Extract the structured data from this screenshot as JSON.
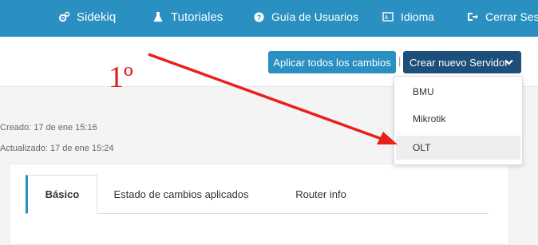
{
  "nav": {
    "items": [
      {
        "label": "Sidekiq",
        "icon": "cogs-icon"
      },
      {
        "label": "Tutoriales",
        "icon": "flask-icon"
      },
      {
        "label": "Guía de Usuarios",
        "icon": "question-circle-icon"
      },
      {
        "label": "Idioma",
        "icon": "language-icon"
      },
      {
        "label": "Cerrar Sesió",
        "icon": "sign-out-icon"
      }
    ]
  },
  "toolbar": {
    "apply_label": "Aplicar todos los cambios",
    "separator": "|",
    "new_server_label": "Crear nuevo Servidor"
  },
  "dropdown": {
    "items": [
      {
        "label": "BMU"
      },
      {
        "label": "Mikrotik"
      },
      {
        "label": "OLT"
      }
    ]
  },
  "meta": {
    "created": "Creado: 17 de ene 15:16",
    "updated": "Actualizado: 17 de ene 15:24"
  },
  "tabs": [
    {
      "label": "Básico"
    },
    {
      "label": "Estado de cambios aplicados"
    },
    {
      "label": "Router info"
    }
  ],
  "annotation": {
    "step": "1º",
    "color": "#e0201b"
  },
  "colors": {
    "primary": "#2a8fc1",
    "dark_button": "#1d4f7a"
  }
}
